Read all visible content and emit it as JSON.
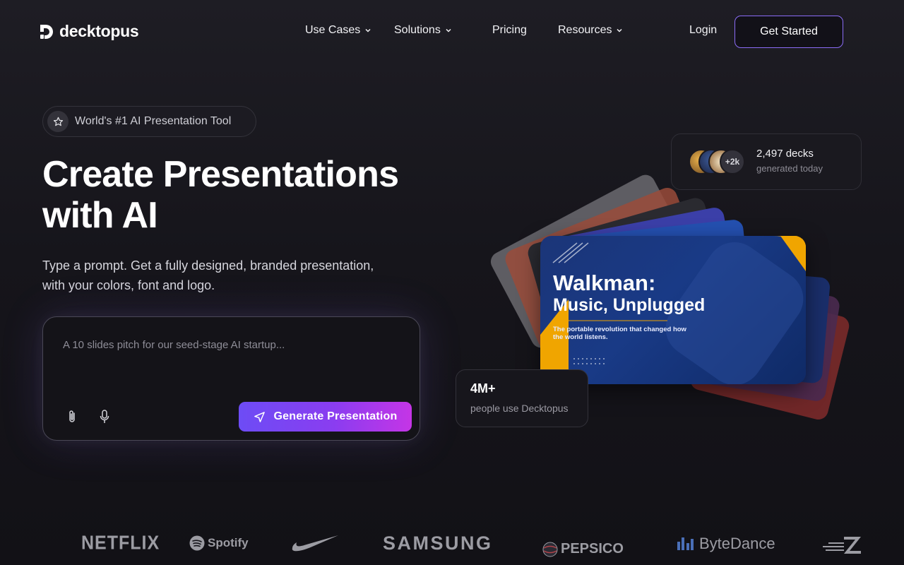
{
  "brand": {
    "name": "decktopus"
  },
  "nav": {
    "links": [
      {
        "label": "Use Cases"
      },
      {
        "label": "Solutions"
      },
      {
        "label": "Pricing"
      },
      {
        "label": "Resources"
      }
    ],
    "login": "Login",
    "cta": "Get Started"
  },
  "hero": {
    "badge": "World's #1 AI Presentation Tool",
    "headline_line1": "Create Presentations",
    "headline_line2": "with AI",
    "subtitle_line1": "Type a prompt. Get a fully designed, branded presentation,",
    "subtitle_line2": "with your colors, font and logo.",
    "prompt": {
      "placeholder": "A 10 slides pitch for our seed-stage AI startup...",
      "button": "Generate Presentation"
    }
  },
  "stats": {
    "decks": {
      "avatar_more": "+2k",
      "count": "2,497 decks",
      "sub": "generated today"
    },
    "users": {
      "count": "4M+",
      "sub": "people use Decktopus"
    }
  },
  "preview_slide": {
    "title": "Walkman:",
    "title2": "Music, Unplugged",
    "subtitle": "The portable revolution that changed how the world listens."
  },
  "logos": [
    "NETFLIX",
    "Spotify",
    "SAMSUNG",
    "PEPSICO",
    "ByteDance"
  ],
  "colors": {
    "accent": "#8b6cf6",
    "button_gradient_start": "#6d4cf5",
    "button_gradient_end": "#c535e6",
    "slide_blue": "#1b3578",
    "slide_orange": "#f0a500"
  }
}
